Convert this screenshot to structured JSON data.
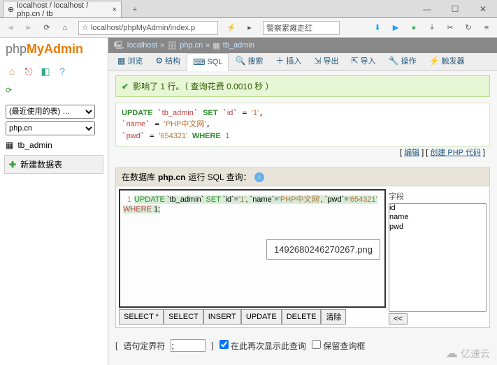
{
  "browser": {
    "tab_title": "localhost / localhost / php.cn / tb",
    "url": "localhost/phpMyAdmin/index.p",
    "url_extra": "警察累瘫走红",
    "win_min": "—",
    "win_max": "☐",
    "win_close": "✕"
  },
  "sidebar": {
    "logo": {
      "p1": "php",
      "p2": "MyAdmin"
    },
    "recent_label": "(最近使用的表) …",
    "db_select": "php.cn",
    "table_item": "tb_admin",
    "new_table": "新建数据表"
  },
  "breadcrumb": {
    "server": "localhost",
    "db": "php.cn",
    "table": "tb_admin"
  },
  "tabs": {
    "browse": "浏览",
    "structure": "结构",
    "sql": "SQL",
    "search": "搜索",
    "insert": "插入",
    "export": "导出",
    "import": "导入",
    "operations": "操作",
    "triggers": "触发器"
  },
  "success_msg": "影响了 1 行。（ 查询花费 0.0010 秒 ）",
  "sql": {
    "update": "UPDATE",
    "set": "SET",
    "where": "WHERE",
    "tbl": "tb_admin",
    "id": "id",
    "name": "name",
    "pwd": "pwd",
    "val_id": "'1'",
    "val_name": "'PHP中文网'",
    "val_pwd": "'654321'",
    "one": "1"
  },
  "sql_links": {
    "edit": "编辑",
    "create": "创建 PHP 代码"
  },
  "query": {
    "head_prefix": "在数据库 ",
    "head_db": "php.cn",
    "head_suffix": " 运行 SQL 查询：",
    "editor_text": "UPDATE `tb_admin` SET `id`='1', `name`='PHP中文网', `pwd`='654321' WHERE 1;",
    "overlay": "1492680246270267.png",
    "cols_label": "字段",
    "cols": [
      "id",
      "name",
      "pwd"
    ],
    "btns": {
      "select_all": "SELECT *",
      "select": "SELECT",
      "insert": "INSERT",
      "update": "UPDATE",
      "delete": "DELETE",
      "clear": "清除"
    },
    "cols_btn": "<<"
  },
  "opts": {
    "delim_label": "语句定界符",
    "delim_value": ";",
    "show_again": "在此再次显示此查询",
    "keep": "保留查询框"
  },
  "watermark": "亿速云"
}
